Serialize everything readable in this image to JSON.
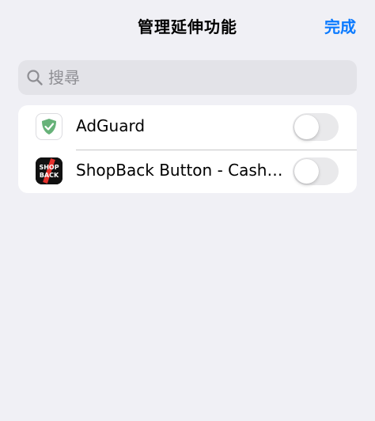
{
  "nav": {
    "title": "管理延伸功能",
    "done_label": "完成",
    "accent_color": "#0a7aff"
  },
  "search": {
    "placeholder": "搜尋",
    "value": ""
  },
  "extensions": [
    {
      "name": "AdGuard",
      "icon": "adguard-shield-icon",
      "enabled": false
    },
    {
      "name": "ShopBack Button - Cash…",
      "icon": "shopback-logo-icon",
      "icon_text_top": "SHOP",
      "icon_text_bottom": "BACK",
      "enabled": false
    }
  ]
}
